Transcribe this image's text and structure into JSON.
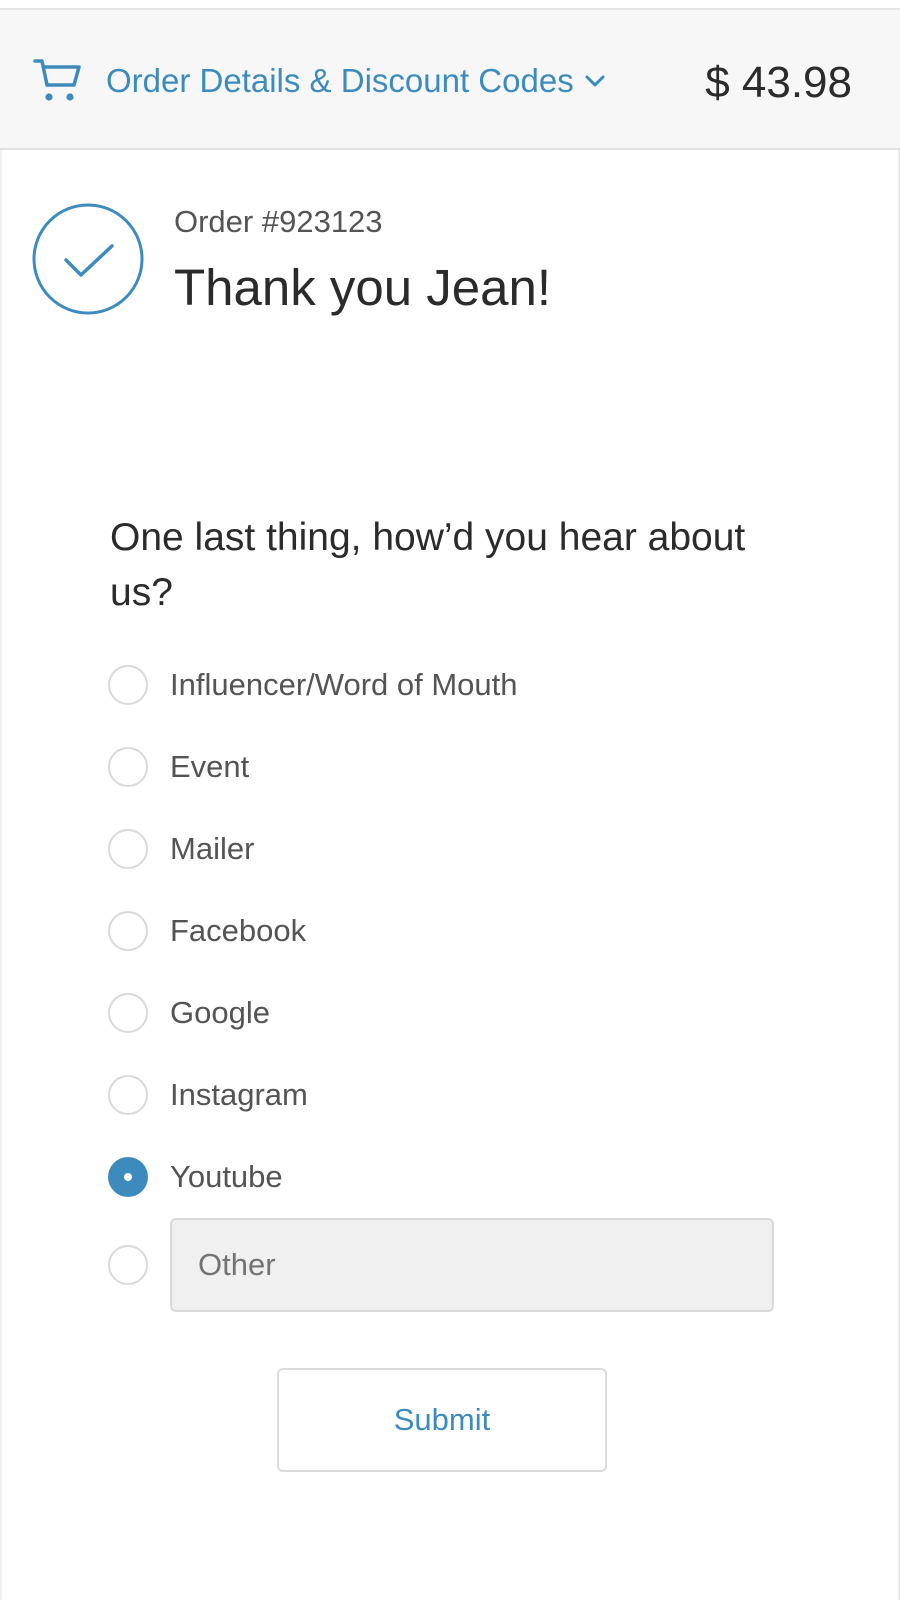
{
  "header": {
    "cart_icon": "cart-icon",
    "summary_toggle_label": "Order Details & Discount Codes",
    "chevron_icon": "chevron-down-icon",
    "total": "$ 43.98"
  },
  "confirmation": {
    "icon": "check-circle-icon",
    "order_number": "Order #923123",
    "thank_you": "Thank you Jean!"
  },
  "survey": {
    "question": "One last thing, how’d you hear about us?",
    "options": [
      {
        "label": "Influencer/Word of Mouth",
        "selected": false
      },
      {
        "label": "Event",
        "selected": false
      },
      {
        "label": "Mailer",
        "selected": false
      },
      {
        "label": "Facebook",
        "selected": false
      },
      {
        "label": "Google",
        "selected": false
      },
      {
        "label": "Instagram",
        "selected": false
      },
      {
        "label": "Youtube",
        "selected": true
      }
    ],
    "other": {
      "selected": false,
      "placeholder": "Other",
      "value": ""
    },
    "submit_label": "Submit"
  },
  "colors": {
    "accent": "#3d8bbd",
    "header_bg": "#f7f7f7",
    "text": "#2b2b2b",
    "muted_text": "#545454",
    "input_bg": "#f0f0f0"
  }
}
